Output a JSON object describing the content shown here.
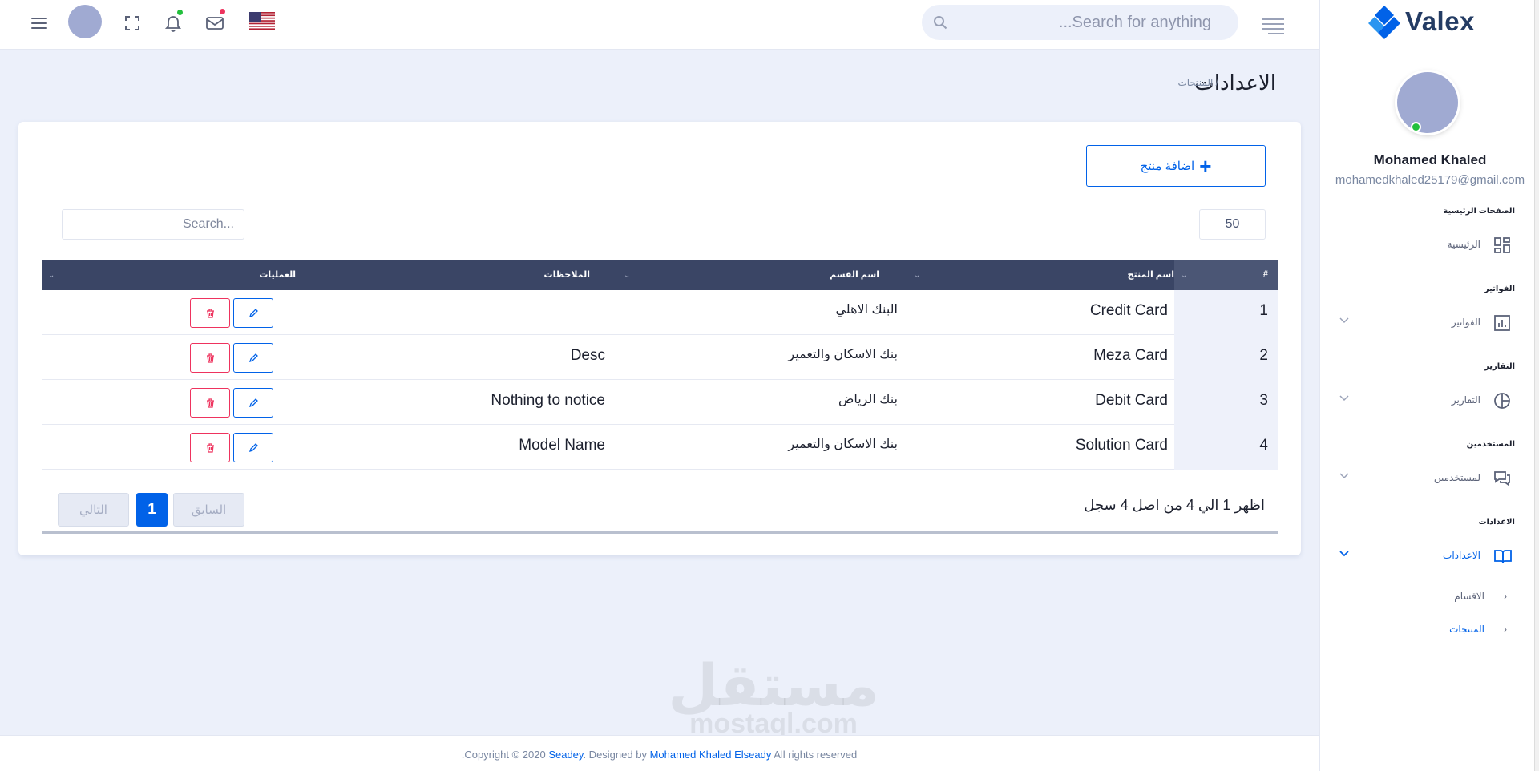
{
  "header": {
    "search_placeholder": "...Search for anything",
    "icons": [
      "menu-icon",
      "avatar",
      "fullscreen-icon",
      "bell-icon",
      "mail-icon",
      "us-flag-icon",
      "search-icon",
      "hamburger-icon"
    ],
    "status_colors": {
      "bell_dot": "#22c03c",
      "mail_dot": "#ee335e"
    }
  },
  "sidebar": {
    "logo_text": "Valex",
    "user_name": "Mohamed Khaled",
    "user_email": "mohamedkhaled25179@gmail.com",
    "sections": [
      {
        "category": "الصفحات الرئيسية",
        "item": "الرئيسية",
        "icon": "dashboard-icon"
      },
      {
        "category": "الفواتير",
        "item": "الفواتير",
        "icon": "bar-chart-icon"
      },
      {
        "category": "التقارير",
        "item": "التقارير",
        "icon": "pie-chart-icon"
      },
      {
        "category": "المستخدمين",
        "item": "لمستخدمين",
        "icon": "chat-icon"
      },
      {
        "category": "الاعدادات",
        "item": "الاعدادات",
        "icon": "book-icon"
      }
    ],
    "sub_items": [
      "الاقسام",
      "المنتجات"
    ]
  },
  "page": {
    "title": "الاعدادات",
    "breadcrumb": "/ المنتجات"
  },
  "toolbar": {
    "add_label": "اضافة منتج",
    "page_size": "50",
    "search_placeholder": "Search..."
  },
  "table": {
    "headers": {
      "id": "#",
      "product_name": "اسم المنتج",
      "section_name": "اسم القسم",
      "notes": "الملاحظات",
      "operations": "العمليات"
    },
    "rows": [
      {
        "id": "1",
        "product_name": "Credit Card",
        "section_name": "البنك الاهلي",
        "notes": ""
      },
      {
        "id": "2",
        "product_name": "Meza Card",
        "section_name": "بنك الاسكان والتعمير",
        "notes": "Desc"
      },
      {
        "id": "3",
        "product_name": "Debit Card",
        "section_name": "بنك الرياض",
        "notes": "Nothing to notice"
      },
      {
        "id": "4",
        "product_name": "Solution Card",
        "section_name": "بنك الاسكان والتعمير",
        "notes": "Model Name"
      }
    ]
  },
  "pagination": {
    "info": "اظهر 1 الي 4 من اصل 4 سجل",
    "prev": "السابق",
    "current": "1",
    "next": "التالي"
  },
  "watermark": {
    "line1": "مستقل",
    "line2": "mostaql.com"
  },
  "footer": {
    "prefix": ".Copyright © 2020 ",
    "brand": "Seadey",
    "middle": ". Designed by ",
    "author": "Mohamed Khaled Elseady",
    "suffix": " All rights reserved"
  },
  "colors": {
    "primary": "#0162e8",
    "danger": "#ee335e",
    "table_header": "#3a4565",
    "success": "#22c03c"
  }
}
